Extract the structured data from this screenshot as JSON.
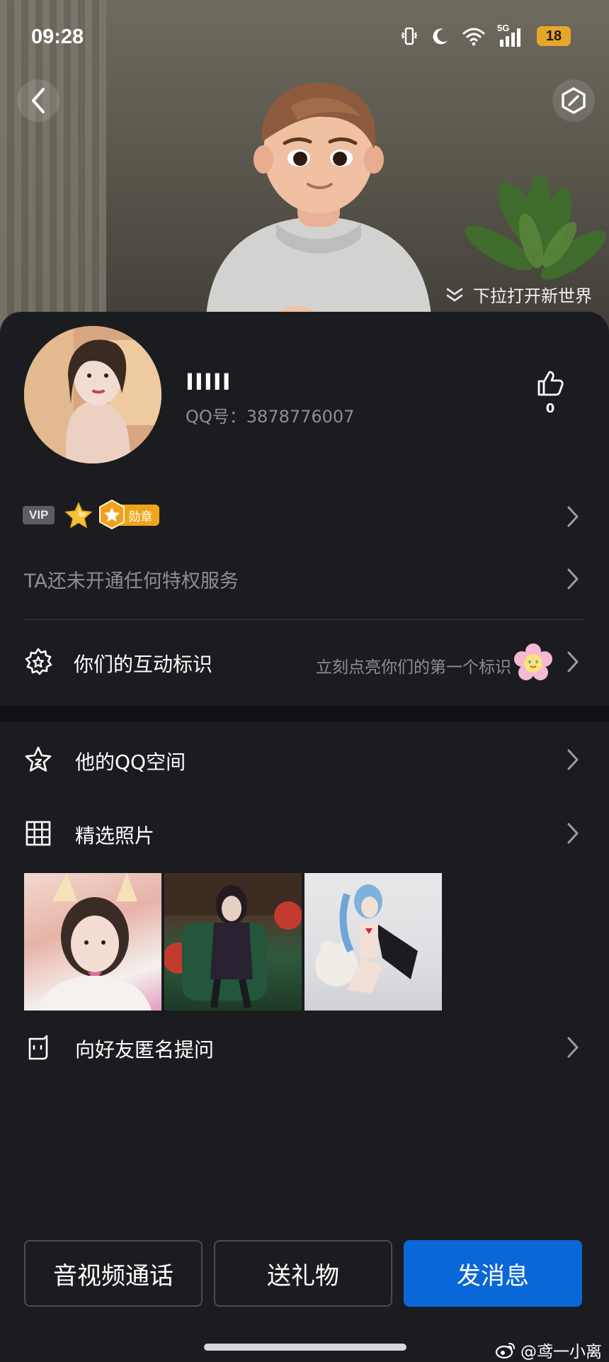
{
  "status_bar": {
    "time": "09:28",
    "network": "5G",
    "battery": "18"
  },
  "header": {
    "pull_hint": "下拉打开新世界"
  },
  "profile": {
    "name": "IIIII",
    "qq_label": "QQ号：3878776007",
    "like_count": "0"
  },
  "badges": {
    "vip": "VIP",
    "medal_label": "勋章"
  },
  "privilege_text": "TA还未开通任何特权服务",
  "interaction": {
    "title": "你们的互动标识",
    "hint": "立刻点亮你们的第一个标识"
  },
  "qzone": {
    "title": "他的QQ空间"
  },
  "photos": {
    "title": "精选照片",
    "count": 3
  },
  "ask": {
    "title": "向好友匿名提问"
  },
  "actions": {
    "call": "音视频通话",
    "gift": "送礼物",
    "message": "发消息"
  },
  "watermark": "@鸢一小离",
  "colors": {
    "accent": "#0a67d8",
    "medal": "#f0a41a",
    "battery": "#e6a628",
    "background": "#1b1c1f"
  }
}
